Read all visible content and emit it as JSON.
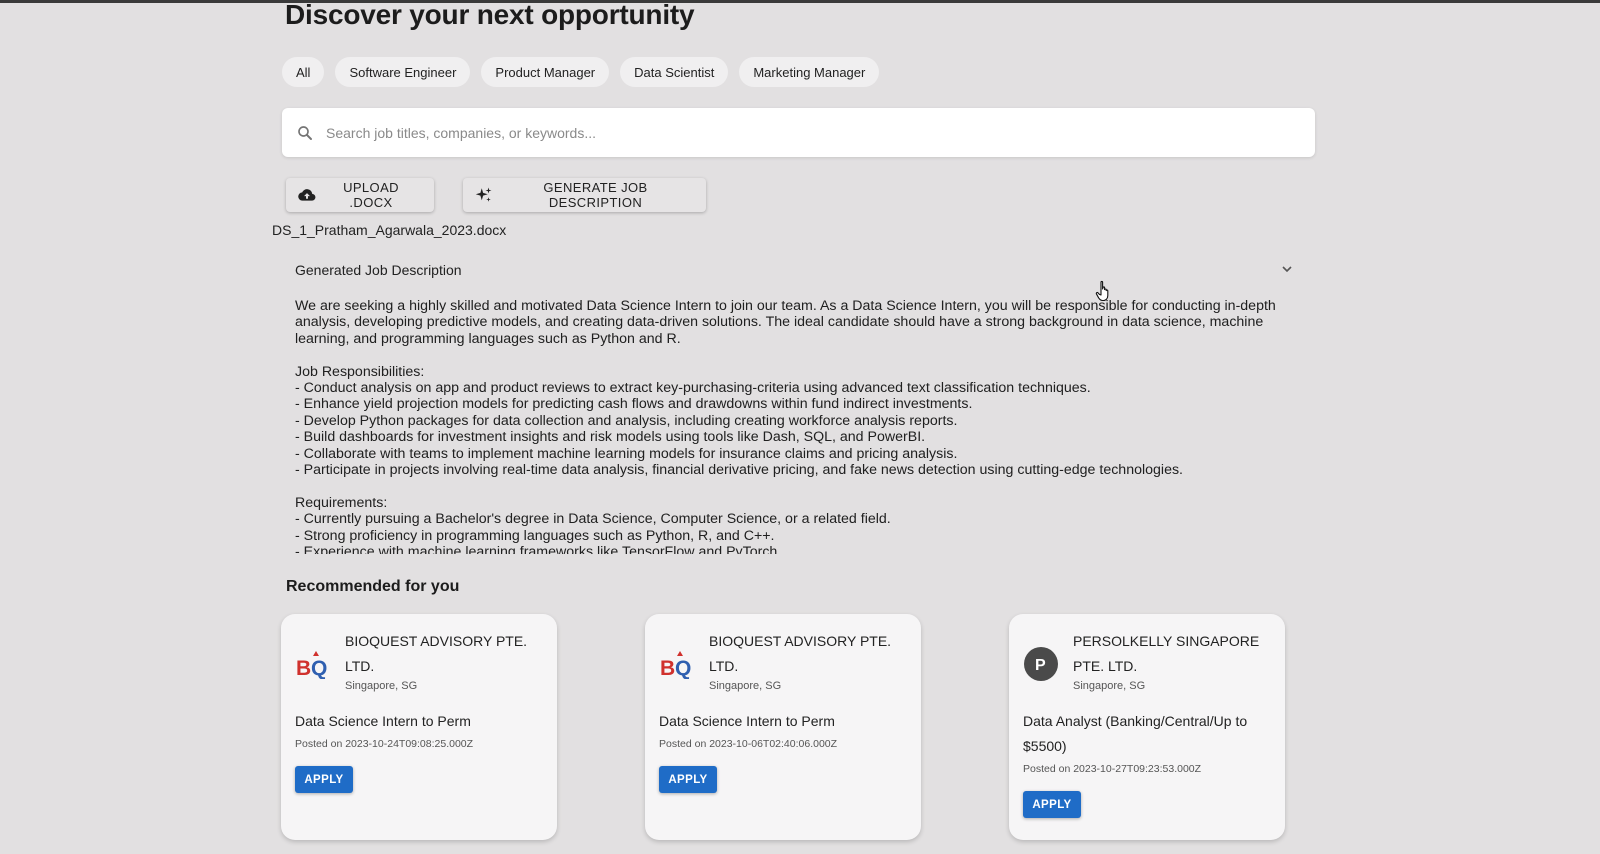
{
  "page": {
    "title": "Discover your next opportunity"
  },
  "filters": [
    "All",
    "Software Engineer",
    "Product Manager",
    "Data Scientist",
    "Marketing Manager"
  ],
  "search": {
    "placeholder": "Search job titles, companies, or keywords...",
    "icon": "search-icon"
  },
  "actions": {
    "upload_label": "UPLOAD .DOCX",
    "upload_icon": "cloud-upload-icon",
    "generate_label": "GENERATE JOB DESCRIPTION",
    "generate_icon": "sparkle-icon"
  },
  "uploaded_file": "DS_1_Pratham_Agarwala_2023.docx",
  "job_description": {
    "title": "Generated Job Description",
    "text": "We are seeking a highly skilled and motivated Data Science Intern to join our team. As a Data Science Intern, you will be responsible for conducting in-depth analysis, developing predictive models, and creating data-driven solutions. The ideal candidate should have a strong background in data science, machine learning, and programming languages such as Python and R.\n\nJob Responsibilities:\n- Conduct analysis on app and product reviews to extract key-purchasing-criteria using advanced text classification techniques.\n- Enhance yield projection models for predicting cash flows and drawdowns within fund indirect investments.\n- Develop Python packages for data collection and analysis, including creating workforce analysis reports.\n- Build dashboards for investment insights and risk models using tools like Dash, SQL, and PowerBI.\n- Collaborate with teams to implement machine learning models for insurance claims and pricing analysis.\n- Participate in projects involving real-time data analysis, financial derivative pricing, and fake news detection using cutting-edge technologies.\n\nRequirements:\n- Currently pursuing a Bachelor's degree in Data Science, Computer Science, or a related field.\n- Strong proficiency in programming languages such as Python, R, and C++.\n- Experience with machine learning frameworks like TensorFlow and PyTorch."
  },
  "recommended": {
    "title": "Recommended for you",
    "jobs": [
      {
        "company": "BIOQUEST ADVISORY PTE. LTD.",
        "logo_text": "BQ",
        "location": "Singapore, SG",
        "title": "Data Science Intern to Perm",
        "posted": "Posted on 2023-10-24T09:08:25.000Z",
        "apply_label": "APPLY"
      },
      {
        "company": "BIOQUEST ADVISORY PTE. LTD.",
        "logo_text": "BQ",
        "location": "Singapore, SG",
        "title": "Data Science Intern to Perm",
        "posted": "Posted on 2023-10-06T02:40:06.000Z",
        "apply_label": "APPLY"
      },
      {
        "company": "PERSOLKELLY SINGAPORE PTE. LTD.",
        "logo_text": "P",
        "location": "Singapore, SG",
        "title": "Data Analyst (Banking/Central/Up to $5500)",
        "posted": "Posted on 2023-10-27T09:23:53.000Z",
        "apply_label": "APPLY"
      }
    ]
  },
  "colors": {
    "background": "#e2e0e1",
    "apply_button": "#1f6cc7",
    "bq_red": "#d0312d",
    "bq_blue": "#2f5fb0"
  }
}
